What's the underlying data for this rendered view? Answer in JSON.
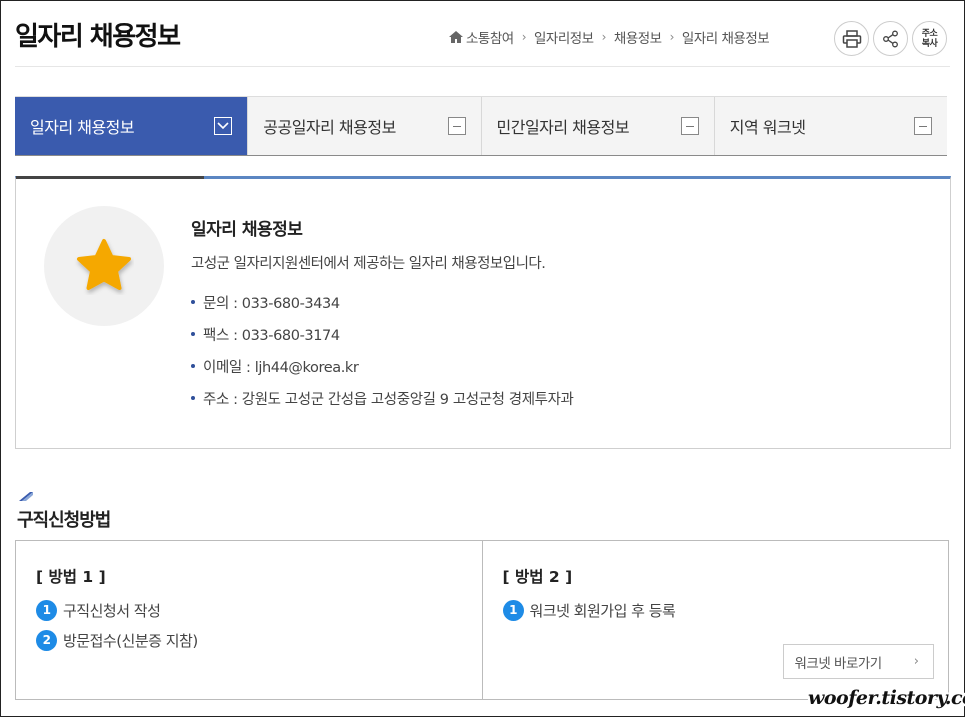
{
  "header": {
    "title": "일자리 채용정보",
    "breadcrumb": [
      "소통참여",
      "일자리정보",
      "채용정보",
      "일자리 채용정보"
    ],
    "tools": {
      "address_copy_label": "주소\n복사"
    }
  },
  "tabs": [
    {
      "label": "일자리 채용정보",
      "active": true
    },
    {
      "label": "공공일자리 채용정보",
      "active": false
    },
    {
      "label": "민간일자리 채용정보",
      "active": false
    },
    {
      "label": "지역 워크넷",
      "active": false
    }
  ],
  "info": {
    "title": "일자리 채용정보",
    "description": "고성군 일자리지원센터에서 제공하는 일자리 채용정보입니다.",
    "items": [
      "문의 : 033-680-3434",
      "팩스 : 033-680-3174",
      "이메일 : ljh44@korea.kr",
      "주소 : 강원도 고성군 간성읍 고성중앙길 9 고성군청 경제투자과"
    ]
  },
  "section": {
    "title": "구직신청방법",
    "methods": [
      {
        "title": "[ 방법 1 ]",
        "steps": [
          {
            "num": "1",
            "text": "구직신청서 작성"
          },
          {
            "num": "2",
            "text": "방문접수(신분증 지참)"
          }
        ]
      },
      {
        "title": "[ 방법 2 ]",
        "steps": [
          {
            "num": "1",
            "text": "워크넷 회원가입 후 등록"
          }
        ],
        "button": "워크넷 바로가기"
      }
    ]
  },
  "watermark": "woofer.tistory.com",
  "colors": {
    "accent": "#3a5bae",
    "number_badge": "#1e8be6",
    "star": "#f5a800"
  }
}
